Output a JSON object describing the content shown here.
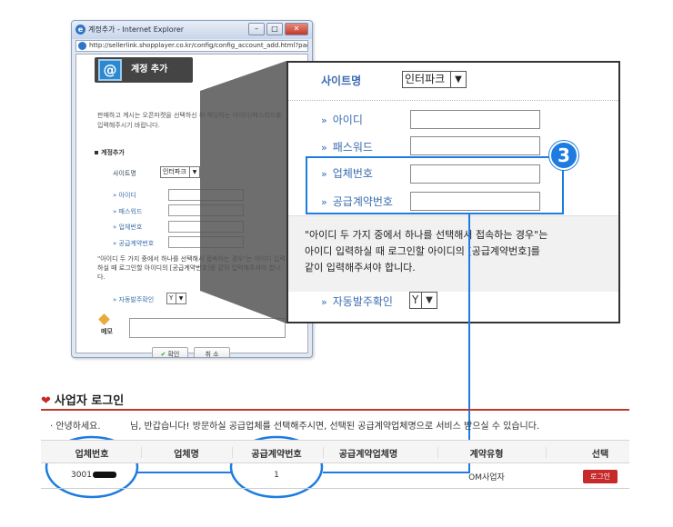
{
  "ie_window": {
    "title": "계정추가 - Internet Explorer",
    "url": "http://sellerlink.shopplayer.co.kr/config/config_account_add.html?page=1",
    "page_title": "계정 추가",
    "intro": "판매하고 계시는 오픈마켓을 선택하신 뒤 해당하는 아이디/패스워드를 입력해주시기 바랍니다.",
    "section_title": "계정추가",
    "site_name_label": "사이트명",
    "site_select_value": "인터파크",
    "fields": [
      "아이디",
      "패스워드",
      "업체번호",
      "공급계약번호"
    ],
    "note": "\"아이디 두 가지 중에서 하나를 선택해서 접속하는 경우\"는 아이디 입력하실 때 로그인할 아이디의 [공급계약번호]를 같이 입력해주셔야 합니다.",
    "auto_order_label": "자동발주확인",
    "auto_order_value": "Y",
    "memo_label": "메모",
    "confirm_button": "확인",
    "cancel_button": "취 소"
  },
  "callout": {
    "site_name_label": "사이트명",
    "site_select_value": "인터파크",
    "fields": {
      "id": "아이디",
      "password": "패스워드",
      "business_number": "업체번호",
      "supply_contract_number": "공급계약번호"
    },
    "note_line1": "\"아이디 두 가지 중에서 하나를 선택해서 접속하는 경우\"는",
    "note_line2": "아이디 입력하실 때 로그인할 아이디의 [공급계약번호]를",
    "note_line3": "같이 입력해주셔야 합니다.",
    "auto_order_label": "자동발주확인",
    "auto_order_value": "Y",
    "step_number": "3"
  },
  "business_login": {
    "title": "사업자 로그인",
    "greeting": "· 안녕하세요.",
    "greeting_rest": "님, 반갑습니다! 방문하실 공급업체를 선택해주시면, 선택된 공급계약업체명으로 서비스 받으실 수 있습니다.",
    "columns": [
      "업체번호",
      "업체명",
      "공급계약번호",
      "공급계약업체명",
      "계약유형",
      "선택"
    ],
    "row": {
      "business_number": "3001",
      "company_name": "",
      "supply_contract_number": "1",
      "supply_contract_company": "",
      "contract_type": "OM사업자",
      "select_button": "로그인"
    }
  },
  "colors": {
    "accent_blue": "#1e7ce0",
    "label_blue": "#3a6cb0",
    "brand_red": "#c62a2a"
  }
}
